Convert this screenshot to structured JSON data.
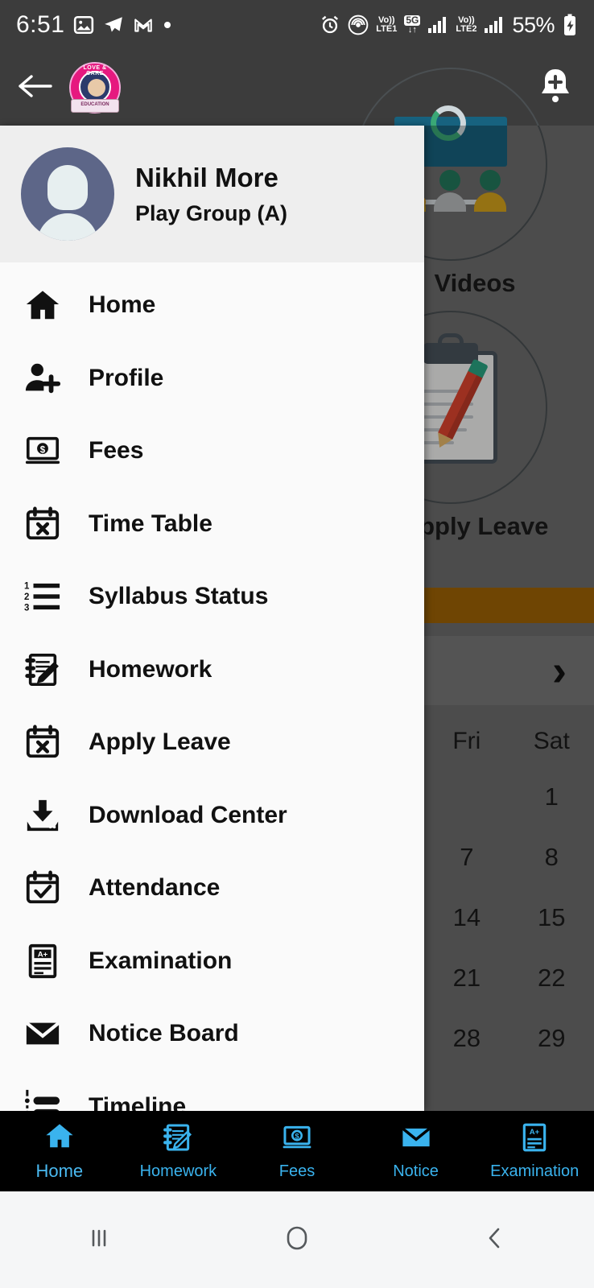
{
  "status_bar": {
    "time": "6:51",
    "left_icons": [
      "photo-icon",
      "telegram-icon",
      "gmail-icon",
      "dot-icon"
    ],
    "right_icons": [
      "alarm-icon",
      "hotspot-icon"
    ],
    "volte1": {
      "top": "Vo))",
      "bottom": "LTE1"
    },
    "network_badge": "5G",
    "volte2": {
      "top": "Vo))",
      "bottom": "LTE2"
    },
    "battery": "55%"
  },
  "app_bar": {
    "back_icon": "back-arrow-icon",
    "logo_top_text": "LOVE & CARE",
    "logo_ribbon_text": "EDUCATION",
    "notification_icon": "bell-add-icon"
  },
  "drawer": {
    "profile": {
      "name": "Nikhil More",
      "class": "Play Group (A)",
      "avatar_icon": "avatar-placeholder-icon"
    },
    "items": [
      {
        "label": "Home",
        "icon": "home-icon"
      },
      {
        "label": "Profile",
        "icon": "person-add-icon"
      },
      {
        "label": "Fees",
        "icon": "money-laptop-icon"
      },
      {
        "label": "Time Table",
        "icon": "calendar-x-icon"
      },
      {
        "label": "Syllabus Status",
        "icon": "numbered-list-icon"
      },
      {
        "label": "Homework",
        "icon": "notebook-pencil-icon"
      },
      {
        "label": "Apply Leave",
        "icon": "calendar-x-icon"
      },
      {
        "label": "Download Center",
        "icon": "download-icon"
      },
      {
        "label": "Attendance",
        "icon": "calendar-check-icon"
      },
      {
        "label": "Examination",
        "icon": "grade-document-icon"
      },
      {
        "label": "Notice Board",
        "icon": "envelope-icon"
      },
      {
        "label": "Timeline",
        "icon": "timeline-list-icon"
      }
    ]
  },
  "background": {
    "tiles": [
      {
        "label": "Videos",
        "icon": "video-lecture-icon"
      },
      {
        "label": "Apply Leave",
        "icon": "clipboard-pencil-icon"
      }
    ],
    "calendar": {
      "next_icon": "chevron-right-icon",
      "day_headers": [
        "",
        "",
        "",
        "",
        "",
        "Fri",
        "Sat"
      ],
      "weeks": [
        [
          "",
          "",
          "",
          "",
          "",
          "",
          "1"
        ],
        [
          "",
          "",
          "",
          "",
          "",
          "7",
          "8"
        ],
        [
          "",
          "",
          "",
          "",
          "",
          "14",
          "15"
        ],
        [
          "",
          "",
          "",
          "",
          "",
          "21",
          "22"
        ],
        [
          "",
          "",
          "",
          "",
          "",
          "28",
          "29"
        ]
      ]
    },
    "band_color": "#a06305"
  },
  "bottom_nav": {
    "accent_color": "#3ab3ee",
    "items": [
      {
        "label": "Home",
        "icon": "home-icon",
        "active": true
      },
      {
        "label": "Homework",
        "icon": "notebook-pencil-icon",
        "active": false
      },
      {
        "label": "Fees",
        "icon": "money-laptop-icon",
        "active": false
      },
      {
        "label": "Notice",
        "icon": "envelope-icon",
        "active": false
      },
      {
        "label": "Examination",
        "icon": "grade-document-icon",
        "active": false
      }
    ]
  },
  "system_nav": {
    "recents_icon": "recents-icon",
    "home_icon": "home-circle-icon",
    "back_icon": "back-chevron-icon"
  }
}
